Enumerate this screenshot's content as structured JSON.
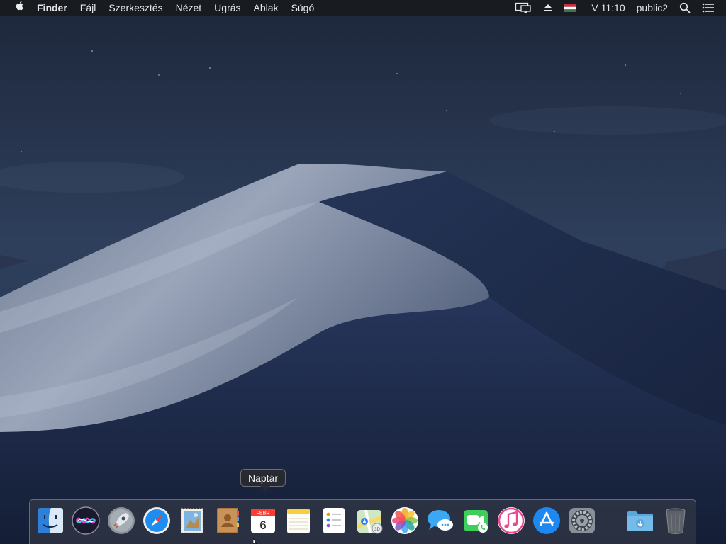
{
  "menubar": {
    "apple_icon": "apple-logo-icon",
    "app_name": "Finder",
    "menus": [
      "Fájl",
      "Szerkesztés",
      "Nézet",
      "Ugrás",
      "Ablak",
      "Súgó"
    ],
    "status": {
      "display_icon": "airplay-display-icon",
      "eject_icon": "eject-icon",
      "input_flag_icon": "hungarian-flag-icon",
      "clock": "V 11:10",
      "user": "public2",
      "search_icon": "spotlight-search-icon",
      "notification_icon": "notification-center-icon"
    }
  },
  "tooltip": {
    "text": "Naptár"
  },
  "dock": {
    "items": [
      {
        "name": "Finder",
        "icon": "finder-icon",
        "running": true
      },
      {
        "name": "Siri",
        "icon": "siri-icon"
      },
      {
        "name": "Launchpad",
        "icon": "launchpad-rocket-icon"
      },
      {
        "name": "Safari",
        "icon": "safari-compass-icon"
      },
      {
        "name": "Mail",
        "icon": "mail-stamp-icon"
      },
      {
        "name": "Contacts",
        "icon": "contacts-book-icon"
      },
      {
        "name": "Naptár",
        "icon": "calendar-icon",
        "month": "FEBR",
        "day": "6"
      },
      {
        "name": "Notes",
        "icon": "notes-icon"
      },
      {
        "name": "Reminders",
        "icon": "reminders-icon"
      },
      {
        "name": "Maps",
        "icon": "maps-icon"
      },
      {
        "name": "Photos",
        "icon": "photos-icon"
      },
      {
        "name": "Messages",
        "icon": "messages-icon"
      },
      {
        "name": "FaceTime",
        "icon": "facetime-icon"
      },
      {
        "name": "iTunes",
        "icon": "itunes-icon"
      },
      {
        "name": "App Store",
        "icon": "app-store-icon"
      },
      {
        "name": "System Preferences",
        "icon": "system-preferences-gear-icon"
      },
      {
        "name": "Downloads",
        "icon": "downloads-folder-icon"
      },
      {
        "name": "Trash",
        "icon": "trash-icon"
      }
    ]
  },
  "colors": {
    "menubar_bg": "#181a1e",
    "desktop_sky": "#26344c",
    "dune_light": "#a7b1c4"
  }
}
